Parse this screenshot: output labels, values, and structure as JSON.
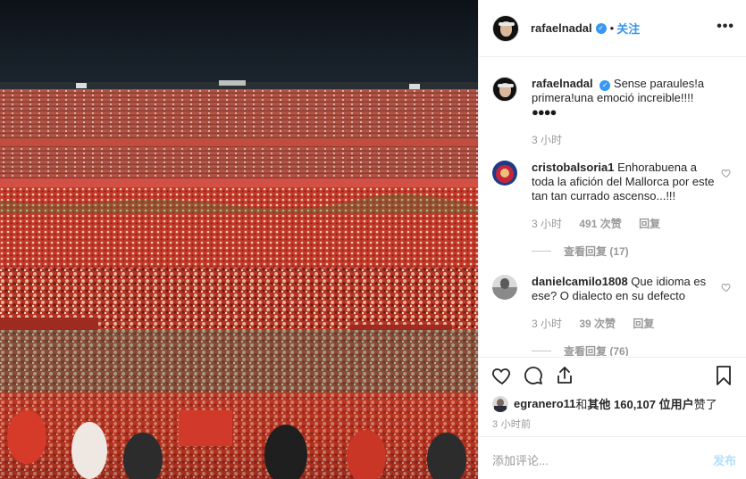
{
  "header": {
    "username": "rafaelnadal",
    "verified_mark": "✓",
    "separator": "•",
    "follow_label": "关注",
    "more_label": "•••"
  },
  "caption": {
    "username": "rafaelnadal",
    "text": "Sense paraules!a primera!una emoció increible!!!!",
    "emoji": "●●●●",
    "time": "3 小时"
  },
  "comments": [
    {
      "username": "cristobalsoria1",
      "text": "Enhorabuena a toda la afición del Mallorca por este tan tan currado ascenso...!!!",
      "time": "3 小时",
      "likes": "491 次赞",
      "reply": "回复",
      "view_replies": "查看回复 (17)"
    },
    {
      "username": "danielcamilo1808",
      "text": "Que idioma es ese? O dialecto en su defecto",
      "time": "3 小时",
      "likes": "39 次赞",
      "reply": "回复",
      "view_replies": "查看回复 (76)"
    }
  ],
  "likes": {
    "user": "egranero11",
    "connector": " 和 ",
    "others": "其他 160,107 位用户",
    "suffix": " 赞了"
  },
  "post_time": "3 小时前",
  "add_comment": {
    "placeholder": "添加评论...",
    "post_label": "发布"
  },
  "icons": [
    "heart-icon",
    "comment-icon",
    "share-icon",
    "bookmark-icon",
    "more-icon",
    "verified-icon"
  ],
  "colors": {
    "accent": "#3897f0",
    "muted_text": "#999999",
    "border": "#efefef",
    "post_disabled": "#b2dffc"
  }
}
